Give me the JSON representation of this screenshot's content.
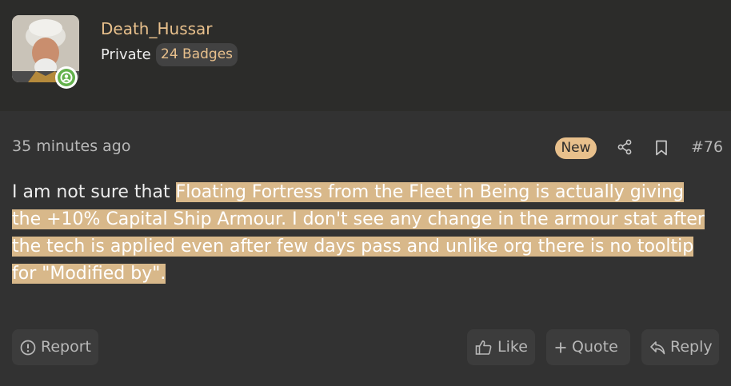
{
  "user": {
    "name": "Death_Hussar",
    "rank": "Private",
    "badges": "24 Badges",
    "status_color": "#63b14c"
  },
  "post": {
    "timestamp": "35 minutes ago",
    "new_label": "New",
    "number": "#76",
    "text_plain": "I am not sure that ",
    "text_highlighted": "Floating Fortress from the Fleet in Being is actually giving the +10% Capital Ship Armour. I don't see any change in the armour stat after the tech is applied even after few days pass and unlike org there is no tooltip for \"Modified by\"."
  },
  "actions": {
    "report": "Report",
    "like": "Like",
    "quote": "Quote",
    "reply": "Reply"
  },
  "icons": {
    "share": "share-icon",
    "bookmark": "bookmark-icon",
    "report": "alert-circle-icon",
    "like": "thumbs-up-icon",
    "quote": "plus-icon",
    "reply": "reply-icon"
  },
  "colors": {
    "accent": "#e8c08c",
    "highlight": "#d8b88a",
    "background": "#323232",
    "header_background": "#2c2c2a"
  }
}
